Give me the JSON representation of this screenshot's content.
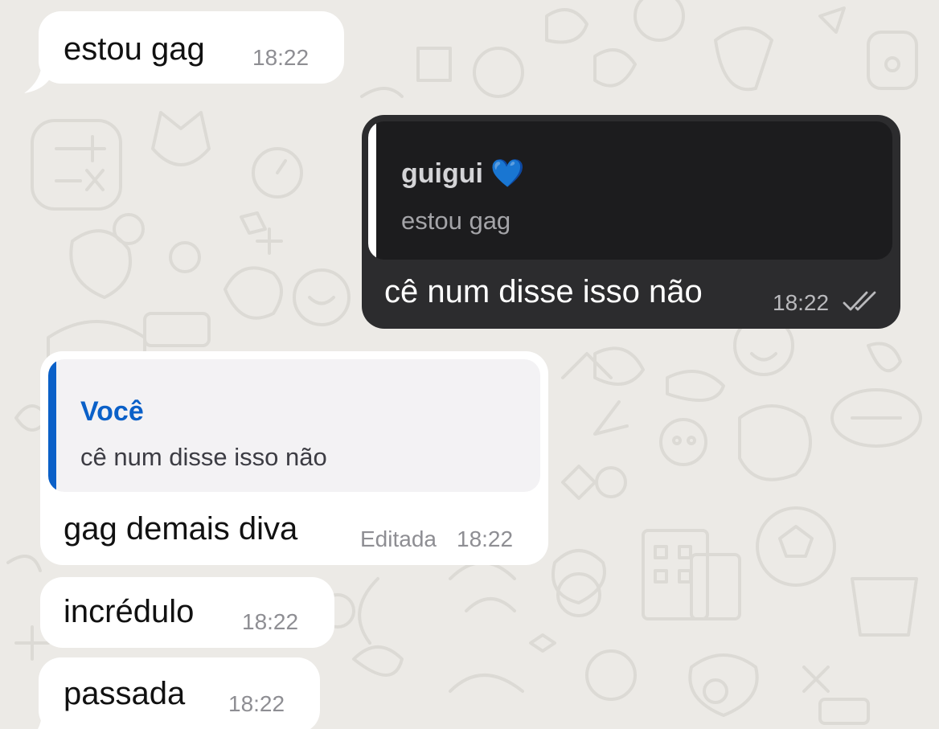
{
  "colors": {
    "chat_background": "#eceae6",
    "incoming_bubble": "#ffffff",
    "outgoing_bubble": "#2c2c2e",
    "outgoing_quote_bg": "#1c1c1e",
    "outgoing_quote_bar": "#ffffff",
    "incoming_quote_bg": "#f3f2f4",
    "incoming_quote_accent": "#0a60c8",
    "timestamp": "#8e8e93"
  },
  "messages": [
    {
      "text": "estou gag",
      "time": "18:22"
    },
    {
      "text": "cê num disse isso não",
      "time": "18:22",
      "status": "read-double-check",
      "reply": {
        "name": "guigui 💙",
        "text": "estou gag"
      }
    },
    {
      "text": "gag demais diva",
      "time": "18:22",
      "edited": "Editada",
      "reply": {
        "name": "Você",
        "text": "cê num disse isso não"
      }
    },
    {
      "text": "incrédulo",
      "time": "18:22"
    },
    {
      "text": "passada",
      "time": "18:22"
    }
  ]
}
